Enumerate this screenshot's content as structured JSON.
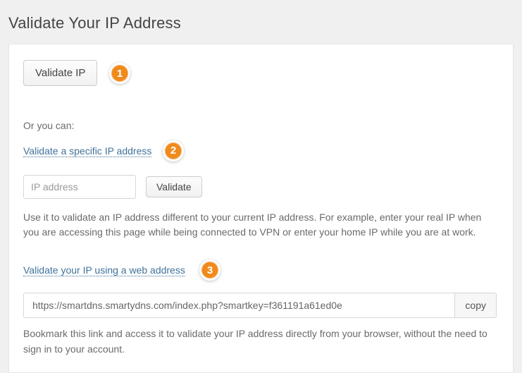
{
  "header": {
    "title": "Validate Your IP Address"
  },
  "validate_ip": {
    "button": "Validate IP",
    "badge": "1"
  },
  "or_text": "Or you can:",
  "specific": {
    "link": "Validate a specific IP address",
    "badge": "2",
    "input_placeholder": "IP address",
    "button": "Validate",
    "help": "Use it to validate an IP address different to your current IP address. For example, enter your real IP when you are accessing this page while being connected to VPN or enter your home IP while you are at work."
  },
  "web_address": {
    "link": "Validate your IP using a web address",
    "badge": "3",
    "url_value": "https://smartdns.smartydns.com/index.php?smartkey=f361191a61ed0e",
    "copy_button": "copy",
    "help": "Bookmark this link and access it to validate your IP address directly from your browser, without the need to sign in to your account."
  }
}
